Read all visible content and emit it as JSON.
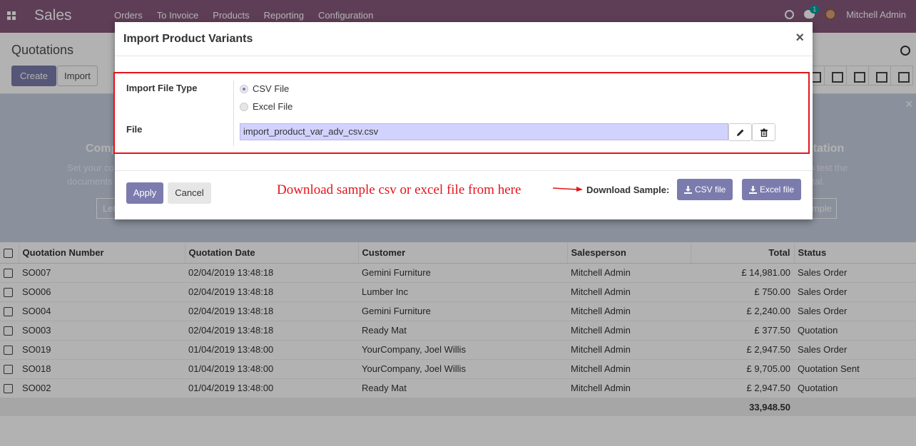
{
  "navbar": {
    "brand": "Sales",
    "menu": [
      "Orders",
      "To Invoice",
      "Products",
      "Reporting",
      "Configuration"
    ],
    "chat_count": "1",
    "user": "Mitchell Admin"
  },
  "control": {
    "title": "Quotations",
    "create_label": "Create",
    "import_label": "Import"
  },
  "banner": {
    "left_title": "Comp",
    "left_line1": "Set your co",
    "left_line2": "documents",
    "left_button": "Let",
    "right_title": "otation",
    "right_line1": "n to test the",
    "right_line2": "portal.",
    "right_button": "mple"
  },
  "modal": {
    "title": "Import Product Variants",
    "close_glyph": "×",
    "import_type_label": "Import File Type",
    "options": [
      "CSV File",
      "Excel File"
    ],
    "selected_option": "CSV File",
    "file_label": "File",
    "file_value": "import_product_var_adv_csv.csv",
    "apply_label": "Apply",
    "cancel_label": "Cancel",
    "annotation": "Download sample csv or excel file from here",
    "download_label": "Download Sample:",
    "csv_button": "CSV file",
    "excel_button": "Excel file"
  },
  "table": {
    "headers": [
      "Quotation Number",
      "Quotation Date",
      "Customer",
      "Salesperson",
      "Total",
      "Status"
    ],
    "rows": [
      [
        "SO007",
        "02/04/2019 13:48:18",
        "Gemini Furniture",
        "Mitchell Admin",
        "£ 14,981.00",
        "Sales Order"
      ],
      [
        "SO006",
        "02/04/2019 13:48:18",
        "Lumber Inc",
        "Mitchell Admin",
        "£ 750.00",
        "Sales Order"
      ],
      [
        "SO004",
        "02/04/2019 13:48:18",
        "Gemini Furniture",
        "Mitchell Admin",
        "£ 2,240.00",
        "Sales Order"
      ],
      [
        "SO003",
        "02/04/2019 13:48:18",
        "Ready Mat",
        "Mitchell Admin",
        "£ 377.50",
        "Quotation"
      ],
      [
        "SO019",
        "01/04/2019 13:48:00",
        "YourCompany, Joel Willis",
        "Mitchell Admin",
        "£ 2,947.50",
        "Sales Order"
      ],
      [
        "SO018",
        "01/04/2019 13:48:00",
        "YourCompany, Joel Willis",
        "Mitchell Admin",
        "£ 9,705.00",
        "Quotation Sent"
      ],
      [
        "SO002",
        "01/04/2019 13:48:00",
        "Ready Mat",
        "Mitchell Admin",
        "£ 2,947.50",
        "Quotation"
      ]
    ],
    "total": "33,948.50"
  },
  "colors": {
    "brand": "#875a7b",
    "primary_button": "#7c7bad",
    "highlight": "#e4141b",
    "file_input_bg": "#d2d2ff"
  }
}
